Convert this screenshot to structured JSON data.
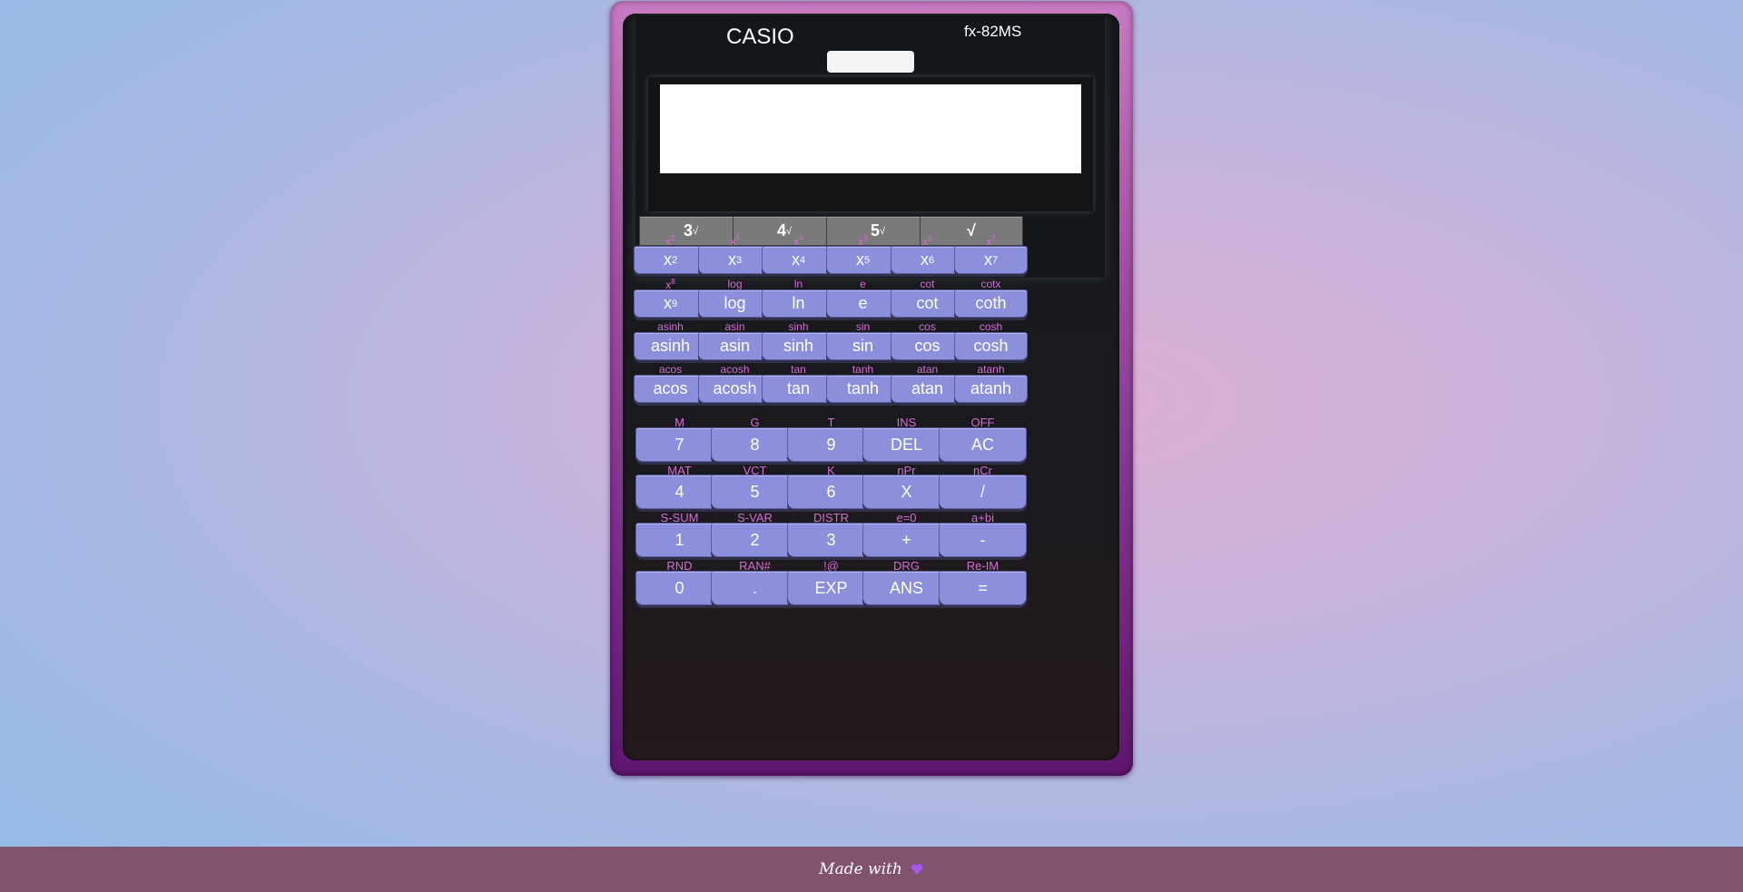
{
  "calculator": {
    "brand": "CASIO",
    "model": "fx-82MS",
    "display_value": ""
  },
  "root_keys": [
    {
      "base": "3",
      "sup": "√"
    },
    {
      "base": "4",
      "sup": "√"
    },
    {
      "base": "5",
      "sup": "√"
    },
    {
      "base": "√",
      "sup": ""
    }
  ],
  "sci_rows": [
    [
      {
        "label": "x",
        "label_sup": "2",
        "key": "x",
        "key_sup": "2"
      },
      {
        "label": "x",
        "label_sup": "3",
        "key": "x",
        "key_sup": "3"
      },
      {
        "label": "x",
        "label_sup": "4",
        "key": "x",
        "key_sup": "4"
      },
      {
        "label": "x",
        "label_sup": "5",
        "key": "x",
        "key_sup": "5"
      },
      {
        "label": "x",
        "label_sup": "6",
        "key": "x",
        "key_sup": "6"
      },
      {
        "label": "x",
        "label_sup": "7",
        "key": "x",
        "key_sup": "7"
      }
    ],
    [
      {
        "label": "x",
        "label_sup": "8",
        "key": "x",
        "key_sup": "9"
      },
      {
        "label": "log",
        "label_sup": "",
        "key": "log",
        "key_sup": ""
      },
      {
        "label": "ln",
        "label_sup": "",
        "key": "ln",
        "key_sup": ""
      },
      {
        "label": "e",
        "label_sup": "",
        "key": "e",
        "key_sup": ""
      },
      {
        "label": "cot",
        "label_sup": "",
        "key": "cot",
        "key_sup": ""
      },
      {
        "label": "cotx",
        "label_sup": "",
        "key": "coth",
        "key_sup": ""
      }
    ],
    [
      {
        "label": "asinh",
        "label_sup": "",
        "key": "asinh",
        "key_sup": ""
      },
      {
        "label": "asin",
        "label_sup": "",
        "key": "asin",
        "key_sup": ""
      },
      {
        "label": "sinh",
        "label_sup": "",
        "key": "sinh",
        "key_sup": ""
      },
      {
        "label": "sin",
        "label_sup": "",
        "key": "sin",
        "key_sup": ""
      },
      {
        "label": "cos",
        "label_sup": "",
        "key": "cos",
        "key_sup": ""
      },
      {
        "label": "cosh",
        "label_sup": "",
        "key": "cosh",
        "key_sup": ""
      }
    ],
    [
      {
        "label": "acos",
        "label_sup": "",
        "key": "acos",
        "key_sup": ""
      },
      {
        "label": "acosh",
        "label_sup": "",
        "key": "acosh",
        "key_sup": ""
      },
      {
        "label": "tan",
        "label_sup": "",
        "key": "tan",
        "key_sup": ""
      },
      {
        "label": "tanh",
        "label_sup": "",
        "key": "tanh",
        "key_sup": ""
      },
      {
        "label": "atan",
        "label_sup": "",
        "key": "atan",
        "key_sup": ""
      },
      {
        "label": "atanh",
        "label_sup": "",
        "key": "atanh",
        "key_sup": ""
      }
    ]
  ],
  "num_rows": [
    [
      {
        "label": "M",
        "key": "7"
      },
      {
        "label": "G",
        "key": "8"
      },
      {
        "label": "T",
        "key": "9"
      },
      {
        "label": "INS",
        "key": "DEL"
      },
      {
        "label": "OFF",
        "key": "AC"
      }
    ],
    [
      {
        "label": "MAT",
        "key": "4"
      },
      {
        "label": "VCT",
        "key": "5"
      },
      {
        "label": "K",
        "key": "6"
      },
      {
        "label": "nPr",
        "key": "X"
      },
      {
        "label": "nCr",
        "key": "/"
      }
    ],
    [
      {
        "label": "S-SUM",
        "key": "1"
      },
      {
        "label": "S-VAR",
        "key": "2"
      },
      {
        "label": "DISTR",
        "key": "3"
      },
      {
        "label": "e=0",
        "key": "+"
      },
      {
        "label": "a+bi",
        "key": "-"
      }
    ],
    [
      {
        "label": "RND",
        "key": "0"
      },
      {
        "label": "RAN#",
        "key": "."
      },
      {
        "label": "!@",
        "key": "EXP"
      },
      {
        "label": "DRG",
        "key": "ANS"
      },
      {
        "label": "Re-IM",
        "key": "="
      }
    ]
  ],
  "footer": {
    "text": "Made with",
    "icon": "heart-icon"
  }
}
